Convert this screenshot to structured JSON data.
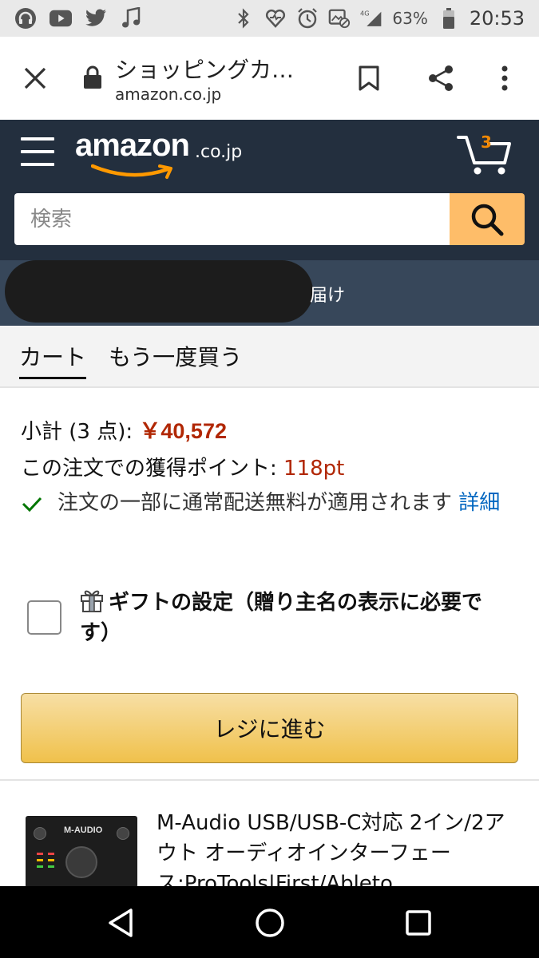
{
  "status_bar": {
    "battery": "63%",
    "time": "20:53",
    "network": "4G",
    "icons_left": [
      "headphones-icon",
      "youtube-icon",
      "twitter-icon",
      "music-note-icon"
    ],
    "icons_right": [
      "bluetooth-icon",
      "heart-monitor-icon",
      "alarm-icon",
      "image-off-icon",
      "signal-icon",
      "battery-icon"
    ]
  },
  "browser": {
    "title": "ショッピングカ…",
    "url": "amazon.co.jp"
  },
  "header": {
    "logo_text": "amazon",
    "logo_tld": ".co.jp",
    "cart_count": "3",
    "search_placeholder": "検索"
  },
  "delivery": {
    "text": "届け"
  },
  "tabs": {
    "cart": "カート",
    "buy_again": "もう一度買う"
  },
  "summary": {
    "subtotal_label": "小計 (3 点): ",
    "subtotal_value": "￥40,572",
    "points_label": "この注文での獲得ポイント: ",
    "points_value": "118pt",
    "free_shipping_text": "注文の一部に通常配送無料が適用されます ",
    "details_link": "詳細"
  },
  "gift": {
    "label": "ギフトの設定（贈り主名の表示に必要です）"
  },
  "checkout": {
    "label": "レジに進む"
  },
  "product": {
    "title": "M-Audio USB/USB-C対応 2イン/2アウト オーディオインターフェース:ProTools|First/Ableto",
    "image_brand": "M-AUDIO"
  },
  "colors": {
    "header_bg": "#232f3e",
    "delivery_bg": "#37475a",
    "search_button": "#febd69",
    "price_red": "#b12704",
    "link_blue": "#0066c0",
    "checkout_yellow": "#f0c14b",
    "check_green": "#007600"
  }
}
